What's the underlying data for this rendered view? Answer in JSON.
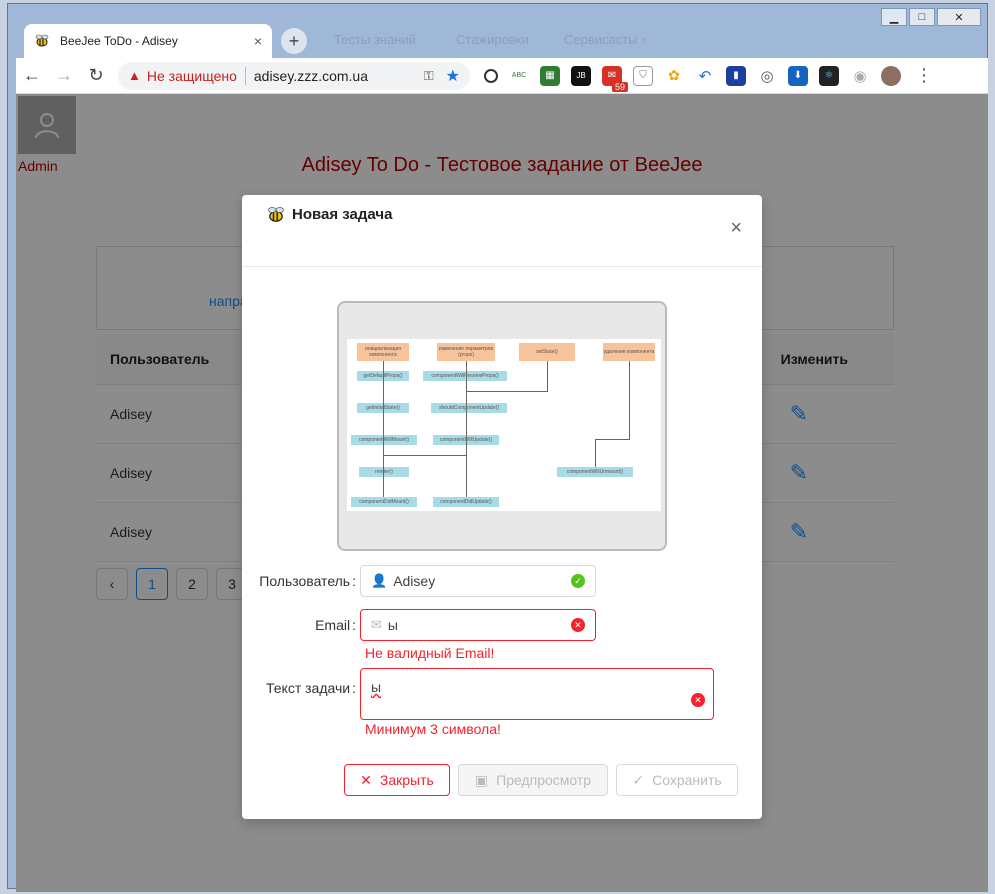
{
  "browser": {
    "tab_title": "BeeJee ToDo - Adisey",
    "tab_close": "×",
    "new_tab": "+",
    "not_secure": "Не защищено",
    "url": "adisey.zzz.com.ua",
    "bg_tabs": [
      "Тесты знаний",
      "Стажировки",
      "Сервисасты ›"
    ],
    "ext_badge": "59",
    "ext_abc": "ABC",
    "ext_jb": "JB"
  },
  "page": {
    "admin_label": "Admin",
    "title": "Adisey To Do - Тестовое задание от BeeJee",
    "filter_link": "напра",
    "table": {
      "headers": [
        "Пользователь",
        "Изменить"
      ],
      "rows": [
        "Adisey",
        "Adisey",
        "Adisey"
      ]
    },
    "pagination": [
      "‹",
      "1",
      "2",
      "3"
    ]
  },
  "modal": {
    "title": "Новая задача",
    "close_icon": "×",
    "preview_diagram": {
      "nodes": [
        "инициализация компонента",
        "изменение параметров (props)",
        "setState()",
        "удаление компонента",
        "getDefaultProps()",
        "componentWillReceiveProps()",
        "getInitialState()",
        "shouldComponentUpdate()",
        "componentWillMount()",
        "componentWillUpdate()",
        "render()",
        "componentWillUnmount()",
        "componentDidMount()",
        "componentDidUpdate()"
      ]
    },
    "user_label": "Пользователь",
    "user_value": "Adisey",
    "email_label": "Email",
    "email_value": "ы",
    "email_error": "Не валидный Email!",
    "text_label": "Текст задачи",
    "text_value": "ы",
    "text_error": "Минимум 3 символа!",
    "btn_close": "Закрыть",
    "btn_preview": "Предпросмотр",
    "btn_save": "Сохранить"
  }
}
